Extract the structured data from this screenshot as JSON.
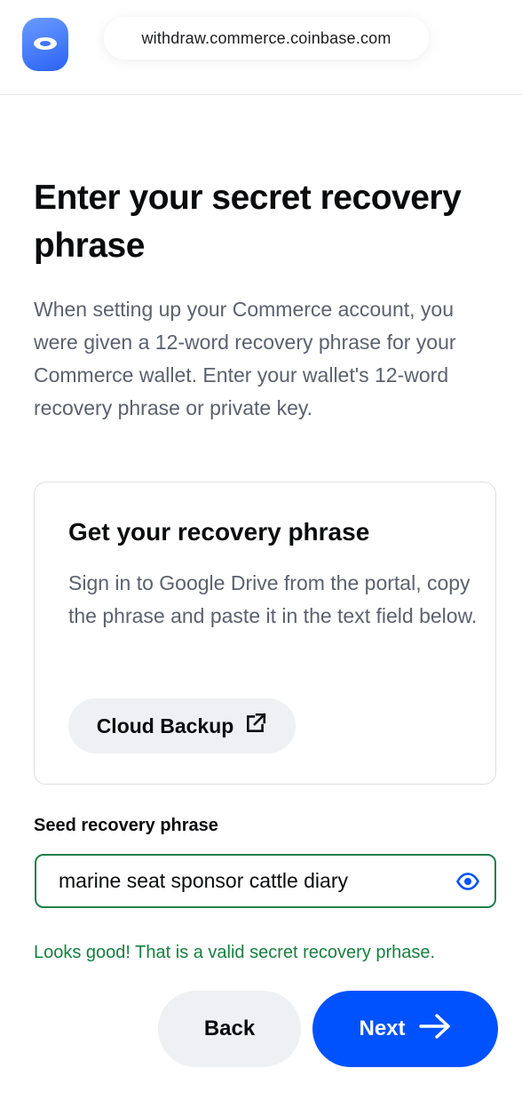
{
  "browser": {
    "url": "withdraw.commerce.coinbase.com",
    "logo_icon": "commerce-logo-icon"
  },
  "page": {
    "title": "Enter your secret recovery phrase",
    "intro": "When setting up your Commerce account, you were given a 12-word recovery phrase for your Commerce wallet. Enter your wallet's 12-word recovery phrase or private key."
  },
  "card": {
    "title": "Get your recovery phrase",
    "text": "Sign in to Google Drive from the portal, copy the phrase and paste it in the text field below.",
    "button_label": "Cloud Backup",
    "button_icon": "external-link-icon"
  },
  "seed": {
    "label": "Seed recovery phrase",
    "value": "marine seat sponsor cattle diary",
    "visibility_icon": "eye-icon",
    "validation_message": "Looks good! That is a valid secret recovery prhase."
  },
  "actions": {
    "back_label": "Back",
    "next_label": "Next",
    "next_icon": "arrow-right-icon"
  },
  "colors": {
    "primary": "#0052ff",
    "success": "#16803f",
    "success_border": "#1b7f4b",
    "muted_text": "#5b616e",
    "secondary_button": "#eef0f3"
  }
}
